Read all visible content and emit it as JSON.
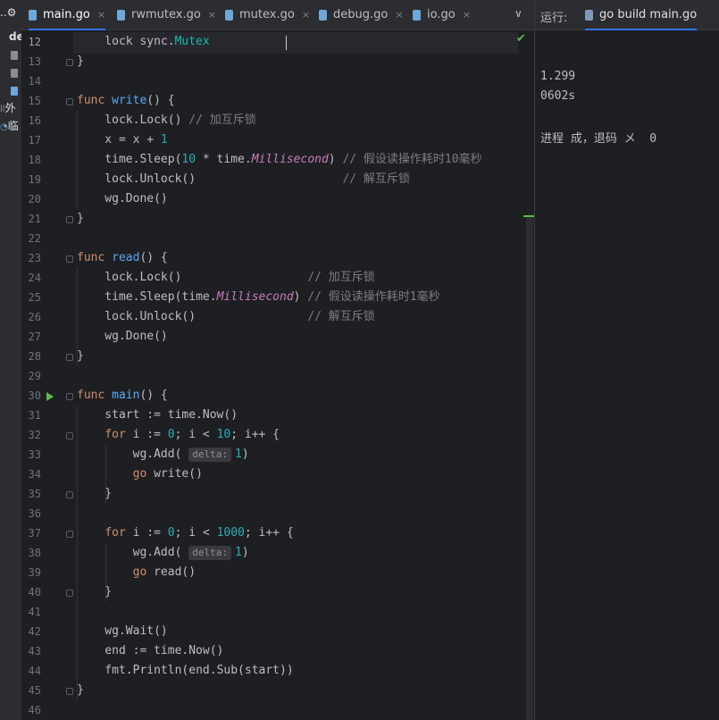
{
  "left_panel": {
    "items": [
      {
        "label": "de"
      },
      {
        "label": "外"
      },
      {
        "label": "临"
      }
    ]
  },
  "editor_tabs": [
    {
      "label": "main.go",
      "close": "×"
    },
    {
      "label": "rwmutex.go",
      "close": "×"
    },
    {
      "label": "mutex.go",
      "close": "×"
    },
    {
      "label": "debug.go",
      "close": "×"
    },
    {
      "label": "io.go",
      "close": "×"
    }
  ],
  "tab_controls": {
    "dropdown": "∨",
    "more": "⋮"
  },
  "editor": {
    "lines": [
      {
        "num": "12",
        "text": "    lock sync.Mutex"
      },
      {
        "num": "13",
        "text": "}"
      },
      {
        "num": "14",
        "text": ""
      },
      {
        "num": "15",
        "text": "func write() {"
      },
      {
        "num": "16",
        "text": "    lock.Lock() // 加互斥锁"
      },
      {
        "num": "17",
        "text": "    x = x + 1"
      },
      {
        "num": "18",
        "text": "    time.Sleep(10 * time.Millisecond) // 假设读操作耗时10毫秒"
      },
      {
        "num": "19",
        "text": "    lock.Unlock()                     // 解互斥锁"
      },
      {
        "num": "20",
        "text": "    wg.Done()"
      },
      {
        "num": "21",
        "text": "}"
      },
      {
        "num": "22",
        "text": ""
      },
      {
        "num": "23",
        "text": "func read() {"
      },
      {
        "num": "24",
        "text": "    lock.Lock()                  // 加互斥锁"
      },
      {
        "num": "25",
        "text": "    time.Sleep(time.Millisecond) // 假设读操作耗时1毫秒"
      },
      {
        "num": "26",
        "text": "    lock.Unlock()                // 解互斥锁"
      },
      {
        "num": "27",
        "text": "    wg.Done()"
      },
      {
        "num": "28",
        "text": "}"
      },
      {
        "num": "29",
        "text": ""
      },
      {
        "num": "30",
        "text": "func main() {"
      },
      {
        "num": "31",
        "text": "    start := time.Now()"
      },
      {
        "num": "32",
        "text": "    for i := 0; i < 10; i++ {"
      },
      {
        "num": "33",
        "text": "        wg.Add( delta: 1)"
      },
      {
        "num": "34",
        "text": "        go write()"
      },
      {
        "num": "35",
        "text": "    }"
      },
      {
        "num": "36",
        "text": ""
      },
      {
        "num": "37",
        "text": "    for i := 0; i < 1000; i++ {"
      },
      {
        "num": "38",
        "text": "        wg.Add( delta: 1)"
      },
      {
        "num": "39",
        "text": "        go read()"
      },
      {
        "num": "40",
        "text": "    }"
      },
      {
        "num": "41",
        "text": ""
      },
      {
        "num": "42",
        "text": "    wg.Wait()"
      },
      {
        "num": "43",
        "text": "    end := time.Now()"
      },
      {
        "num": "44",
        "text": "    fmt.Println(end.Sub(start))"
      },
      {
        "num": "45",
        "text": "}"
      },
      {
        "num": "46",
        "text": ""
      }
    ]
  },
  "run_panel": {
    "label": "运行:",
    "tab": "go build main.go",
    "output": [
      "1.299",
      "0602s",
      "",
      "进程 成，退码 メ  0"
    ]
  },
  "colors": {
    "keyword": "#cf8e6d",
    "function": "#57aaf7",
    "number": "#2aacb8",
    "comment": "#7a7e85",
    "constant": "#c77dbb",
    "type": "#16baac",
    "accent": "#3574f0",
    "run": "#5fb84e"
  }
}
